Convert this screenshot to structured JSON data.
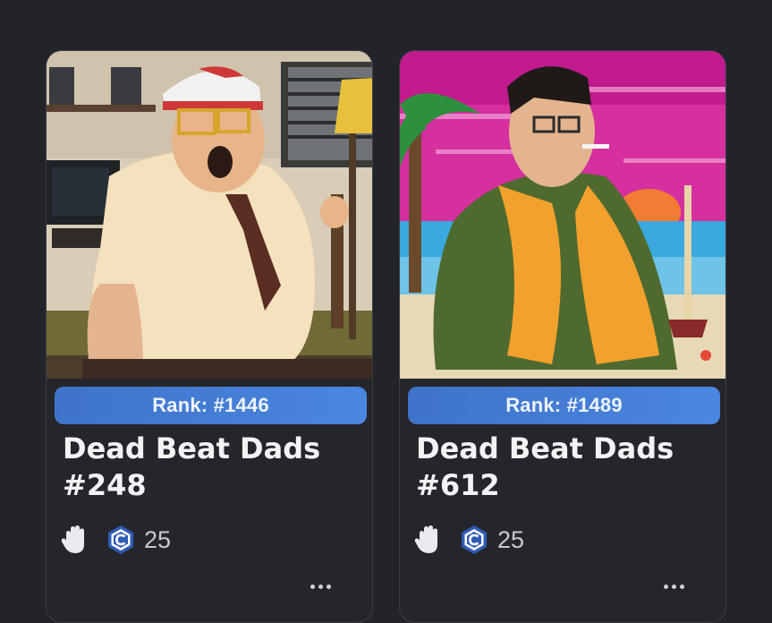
{
  "cards": [
    {
      "rank_label": "Rank: #1446",
      "title_line1": "Dead Beat Dads",
      "title_line2": "#248",
      "price": "25",
      "image_description_icon": "pixel-art-dad-in-office-icon"
    },
    {
      "rank_label": "Rank: #1489",
      "title_line1": "Dead Beat Dads",
      "title_line2": "#612",
      "price": "25",
      "image_description_icon": "pixel-art-dad-on-beach-icon"
    }
  ],
  "icons": {
    "offer": "hand-icon",
    "currency": "coin-icon",
    "more": "more-options-icon"
  },
  "colors": {
    "background": "#222429",
    "card": "#24262c",
    "rank_pill": "#4a86e0",
    "title_text": "#f2f3f5"
  }
}
